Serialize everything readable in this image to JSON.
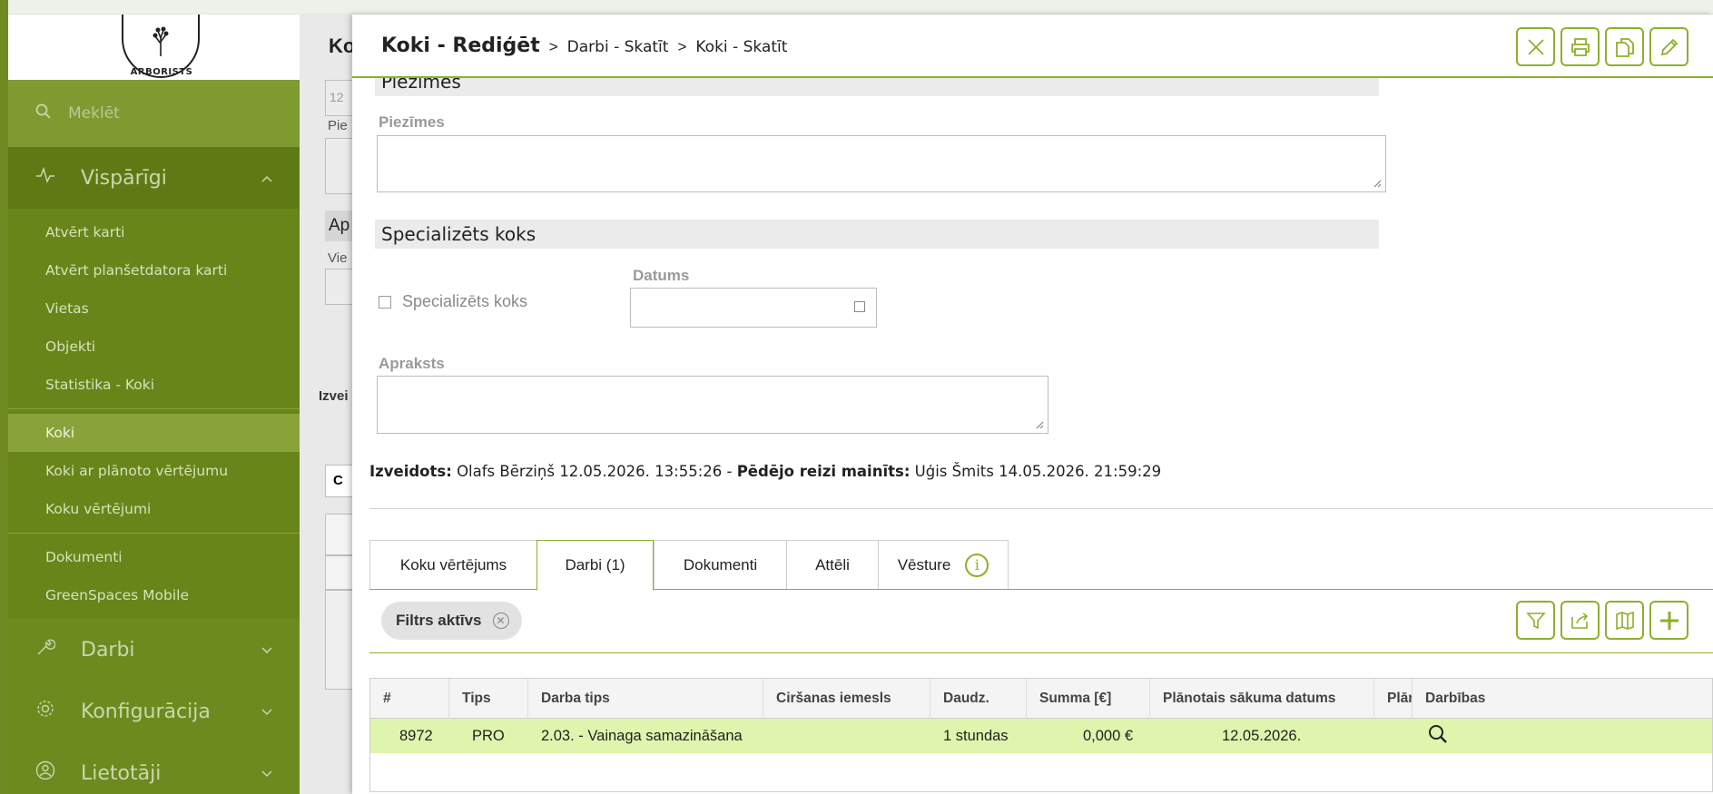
{
  "sidebar": {
    "logo_text": "ARBORISTS",
    "search_placeholder": "Meklēt",
    "sections": [
      {
        "label": "Vispārīgi",
        "icon": "activity-icon"
      },
      {
        "label": "Darbi",
        "icon": "wrench-icon"
      },
      {
        "label": "Konfigurācija",
        "icon": "gear-icon"
      },
      {
        "label": "Lietotāji",
        "icon": "user-icon"
      }
    ],
    "items_group1": [
      "Atvērt karti",
      "Atvērt planšetdatora karti",
      "Vietas",
      "Objekti",
      "Statistika - Koki"
    ],
    "items_group2": [
      "Koki",
      "Koki ar plānoto vērtējumu",
      "Koku vērtējumi"
    ],
    "items_group3": [
      "Dokumenti",
      "GreenSpaces Mobile"
    ]
  },
  "background_page": {
    "title": "Ko",
    "field1": "12",
    "label1": "Pie",
    "section": "Ap",
    "label2": "Vie",
    "label3": "Izvei",
    "tab": "C"
  },
  "header": {
    "title": "Koki - Rediģēt",
    "sep": ">",
    "crumb1": "Darbi - Skatīt",
    "crumb2": "Koki - Skatīt"
  },
  "form": {
    "section_notes": "Piezīmes",
    "notes_label": "Piezīmes",
    "section_special": "Specializēts koks",
    "special_checkbox_label": "Specializēts koks",
    "date_label": "Datums",
    "description_label": "Apraksts"
  },
  "meta": {
    "created_label": "Izveidots:",
    "created_value": "Olafs Bērziņš 12.05.2026. 13:55:26 -",
    "modified_label": "Pēdējo reizi mainīts:",
    "modified_value": "Uģis Šmits 14.05.2026. 21:59:29"
  },
  "tabs": [
    "Koku vērtējums",
    "Darbi (1)",
    "Dokumenti",
    "Attēli",
    "Vēsture"
  ],
  "filter_chip": "Filtrs aktīvs",
  "table": {
    "headers": [
      "#",
      "Tips",
      "Darba tips",
      "Ciršanas iemesls",
      "Daudz.",
      "Summa [€]",
      "Plānotais sākuma datums",
      "Plār",
      "Darbības"
    ],
    "rows": [
      {
        "id": "8972",
        "type": "PRO",
        "work_type": "2.03. - Vainaga samazināšana",
        "reason": "",
        "qty": "1 stundas",
        "sum": "0,000 €",
        "planned_start": "12.05.2026.",
        "planned_end": ""
      }
    ]
  },
  "colors": {
    "accent": "#8cb12a",
    "sidebar": "#6d8a1e",
    "row_highlight": "#dff5ad"
  }
}
